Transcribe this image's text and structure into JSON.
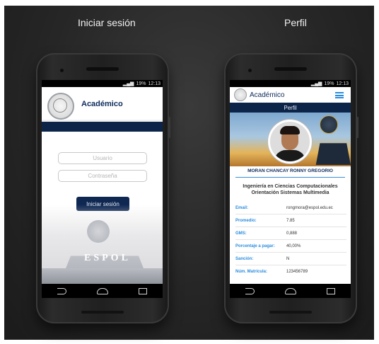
{
  "captions": {
    "left": "Iniciar sesión",
    "right": "Perfil"
  },
  "status_bar": {
    "time": "12:13",
    "battery": "19%"
  },
  "login": {
    "app_title": "Académico",
    "username_placeholder": "Usuario",
    "password_placeholder": "Contraseña",
    "login_button": "Iniciar sesión",
    "background_text": "ESPOL"
  },
  "profile": {
    "app_title": "Académico",
    "section_title": "Perfil",
    "name": "MORAN CHANCAY RONNY GREGORIO",
    "career_line1": "Ingeniería en Ciencias Computacionales",
    "career_line2": "Orientación Sistemas Multimedia",
    "fields": [
      {
        "label": "Email:",
        "value": "rongmora@espol.edu.ec"
      },
      {
        "label": "Promedio:",
        "value": "7.85"
      },
      {
        "label": "GMS:",
        "value": "0,888"
      },
      {
        "label": "Porcentaje a pagar:",
        "value": "40,00%"
      },
      {
        "label": "Sanción:",
        "value": "N"
      },
      {
        "label": "Núm. Matrícula:",
        "value": "123456789"
      }
    ]
  },
  "colors": {
    "primary": "#0c2448",
    "accent": "#2b8de0",
    "title_text": "#0d2b5c"
  },
  "icons": {
    "menu": "hamburger-menu-icon",
    "nav_back": "back-icon",
    "nav_home": "home-icon",
    "nav_recent": "recent-apps-icon"
  }
}
